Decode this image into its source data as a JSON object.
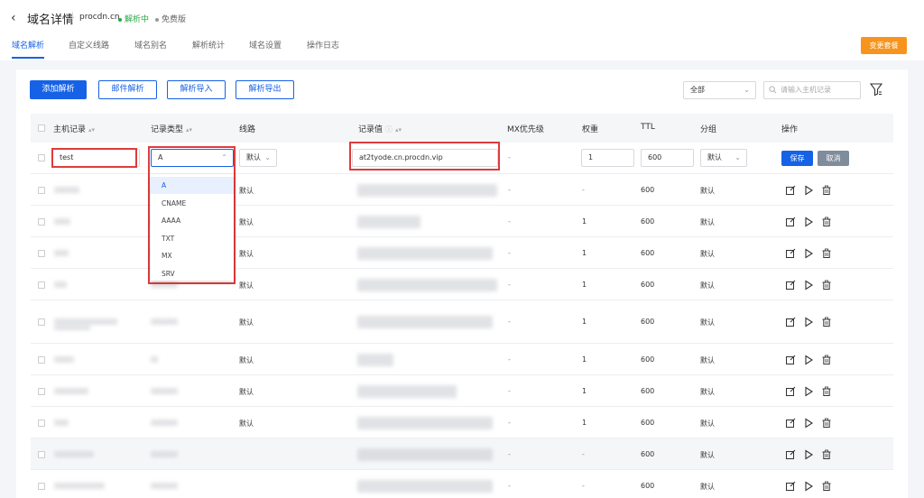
{
  "header": {
    "back_icon": "chevron-left-icon",
    "title": "域名详情",
    "domain": "procdn.cn",
    "status": "解析中",
    "status_color": "#27a844",
    "plan": "免费版",
    "upgrade_label": "变更套餐",
    "upgrade_color": "#f7941d"
  },
  "tabs": [
    "域名解析",
    "自定义线路",
    "域名别名",
    "解析统计",
    "域名设置",
    "操作日志"
  ],
  "active_tab": "域名解析",
  "toolbar": {
    "add_label": "添加解析",
    "mail_label": "邮件解析",
    "import_label": "解析导入",
    "export_label": "解析导出",
    "filter_value": "全部",
    "search_placeholder": "请输入主机记录"
  },
  "table": {
    "columns": [
      "主机记录",
      "记录类型",
      "线路",
      "记录值",
      "MX优先级",
      "权重",
      "TTL",
      "分组",
      "操作"
    ],
    "edit_row": {
      "host": "test",
      "type": "A",
      "line": "默认",
      "value": "at2tyode.cn.procdn.vip",
      "mx": "-",
      "weight": "1",
      "ttl": "600",
      "group": "默认",
      "save_label": "保存",
      "cancel_label": "取消"
    },
    "type_options": [
      "A",
      "CNAME",
      "AAAA",
      "TXT",
      "MX",
      "SRV"
    ],
    "rows": [
      {
        "line": "默认",
        "mx": "-",
        "weight": "-",
        "ttl": "600",
        "group": "默认"
      },
      {
        "line": "默认",
        "mx": "-",
        "weight": "1",
        "ttl": "600",
        "group": "默认"
      },
      {
        "line": "默认",
        "mx": "-",
        "weight": "1",
        "ttl": "600",
        "group": "默认"
      },
      {
        "line": "默认",
        "mx": "-",
        "weight": "1",
        "ttl": "600",
        "group": "默认"
      },
      {
        "line": "默认",
        "mx": "-",
        "weight": "1",
        "ttl": "600",
        "group": "默认"
      },
      {
        "line": "默认",
        "mx": "-",
        "weight": "1",
        "ttl": "600",
        "group": "默认"
      },
      {
        "line": "默认",
        "mx": "-",
        "weight": "1",
        "ttl": "600",
        "group": "默认"
      },
      {
        "line": "默认",
        "mx": "-",
        "weight": "1",
        "ttl": "600",
        "group": "默认"
      },
      {
        "line": "",
        "mx": "-",
        "weight": "-",
        "ttl": "600",
        "group": "默认"
      },
      {
        "line": "",
        "mx": "-",
        "weight": "-",
        "ttl": "600",
        "group": "默认"
      }
    ],
    "action_icons": [
      "edit-icon",
      "play-icon",
      "trash-icon"
    ]
  },
  "accent_color": "#1662e6",
  "highlight_color": "#e03b3b"
}
